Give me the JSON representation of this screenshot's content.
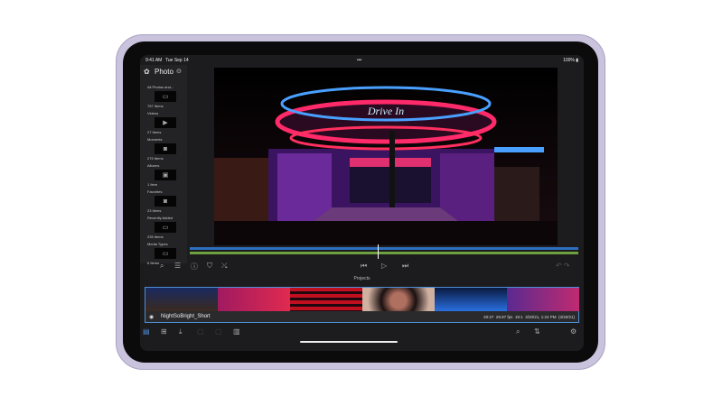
{
  "status": {
    "time": "9:41 AM",
    "date": "Tue Sep 14",
    "battery": "100%"
  },
  "sidebar": {
    "title": "Photo",
    "items": [
      {
        "label": "All Photos and...",
        "count": "757 Items",
        "icon": "folder-icon"
      },
      {
        "label": "Videos",
        "count": "27 Items",
        "icon": "video-icon"
      },
      {
        "label": "Moments",
        "count": "275 Items",
        "icon": "camera-icon"
      },
      {
        "label": "Albums",
        "count": "1 Item",
        "icon": "album-icon"
      },
      {
        "label": "Favorites",
        "count": "23 Items",
        "icon": "camera-icon"
      },
      {
        "label": "Recently Added",
        "count": "235 Items",
        "icon": "folder-icon"
      },
      {
        "label": "Media Types",
        "count": "6 Items",
        "icon": "folder-icon"
      }
    ]
  },
  "preview": {
    "sign": "Drive In"
  },
  "projects": {
    "header": "Projects",
    "name": "NightSoBright_Short",
    "duration": "20:27",
    "fps": "29.97 fps",
    "aspect": "19:1",
    "modified": "3/20/21, 1:24 PM",
    "created": "(3/20/21)"
  },
  "colors": {
    "accent": "#4d8fd6",
    "frame": "#c9c3dd"
  }
}
